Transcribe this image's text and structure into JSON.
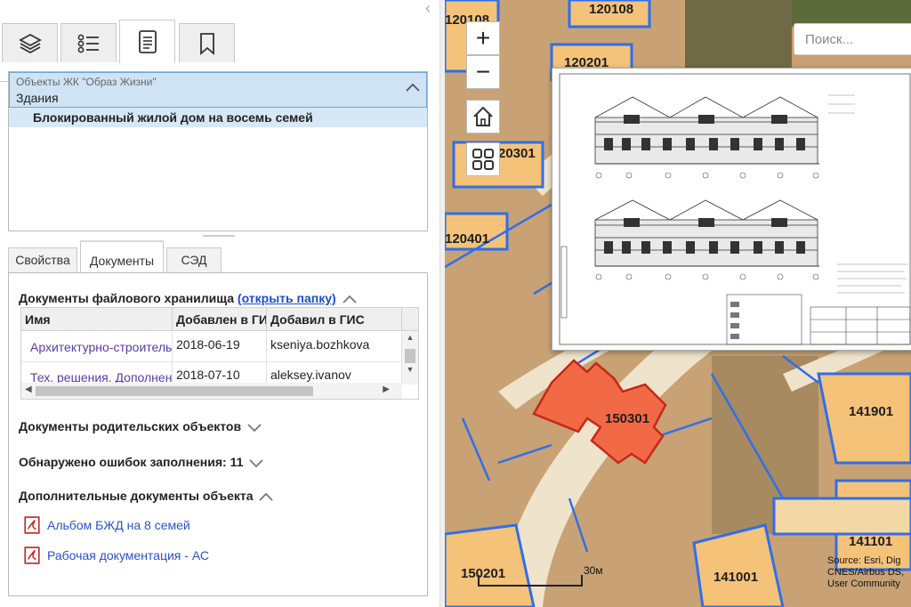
{
  "left_panel": {
    "collapse_glyph": "‹",
    "icon_tabs": [
      {
        "name": "layers-icon"
      },
      {
        "name": "list-icon"
      },
      {
        "name": "document-icon"
      },
      {
        "name": "bookmark-icon"
      }
    ],
    "tree": {
      "caption": "Объекты ЖК \"Образ Жизни\"",
      "group": "Здания",
      "selected_item": "Блокированный жилой дом на восемь семей"
    },
    "tabs": [
      "Свойства",
      "Документы",
      "СЭД"
    ],
    "active_tab": "Документы",
    "storage": {
      "title": "Документы файлового хранилища",
      "open_folder_link": "(открыть папку)",
      "columns": [
        "Имя",
        "Добавлен в ГИС",
        "Добавил в ГИС"
      ],
      "rows": [
        {
          "name": "Архитектурно-строительные решения",
          "date": "2018-06-19",
          "user": "kseniya.bozhkova"
        },
        {
          "name": "Тех. решения. Дополнения",
          "date": "2018-07-10",
          "user": "aleksey.ivanov"
        }
      ]
    },
    "parent_docs_title": "Документы родительских объектов",
    "errors_title": "Обнаружено ошибок заполнения: 11",
    "extra_docs_title": "Дополнительные документы объекта",
    "extra_docs": [
      "Альбом БЖД на 8 семей",
      "Рабочая документация - АС"
    ]
  },
  "map": {
    "search_placeholder": "Поиск...",
    "zoom_in": "+",
    "zoom_out": "−",
    "parcels": [
      "120108",
      "120201",
      "20301",
      "120401",
      "150301",
      "141901",
      "141101",
      "141001",
      "150201"
    ],
    "scale_label": "30м",
    "attribution": [
      "Source: Esri, Dig",
      "CNES/Airbus DS,",
      "User Community"
    ],
    "highlight_color": "#f26a45",
    "parcel_color": "#f5c27a",
    "boundary_color": "#2f6fe8"
  }
}
